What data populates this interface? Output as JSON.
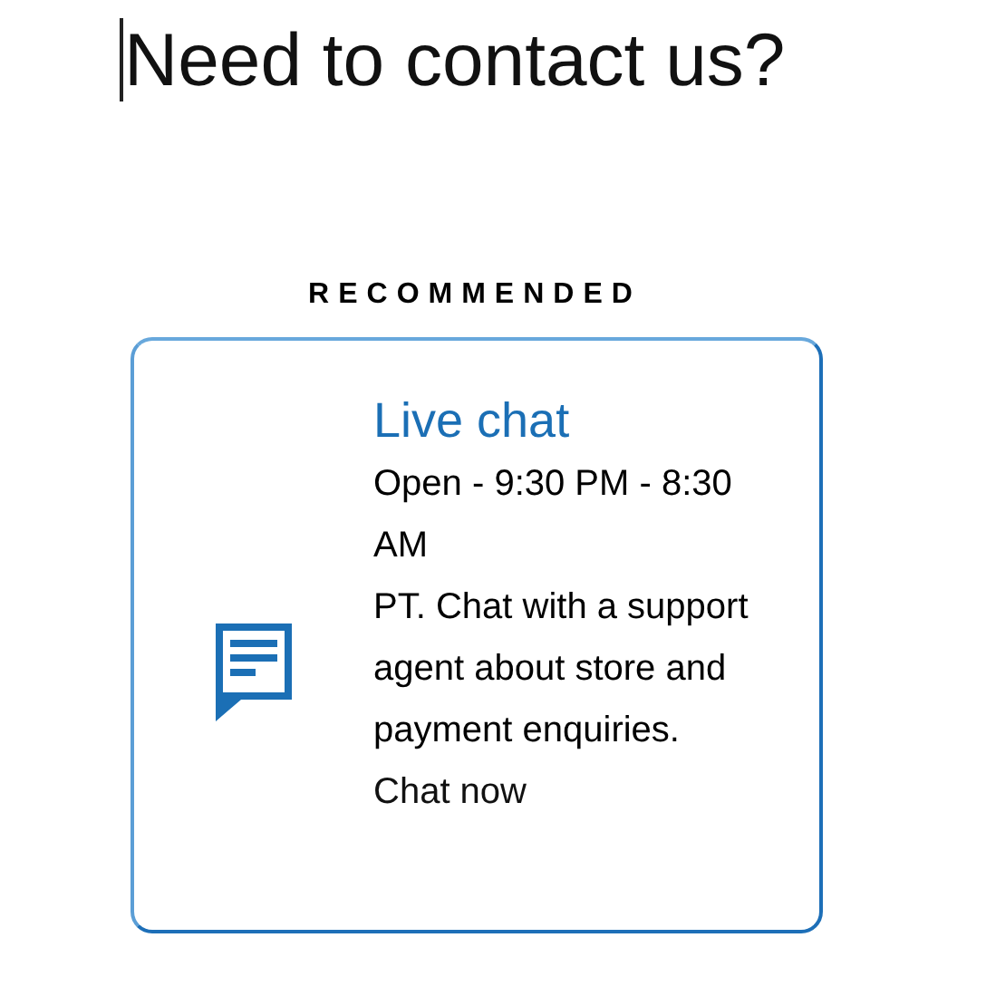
{
  "heading": "Need to contact us?",
  "section_label": "RECOMMENDED",
  "card": {
    "title": "Live chat",
    "hours": "Open - 9:30 PM - 8:30 AM",
    "description": "PT. Chat with a support agent about store and payment enquiries.",
    "link": "Chat now"
  }
}
